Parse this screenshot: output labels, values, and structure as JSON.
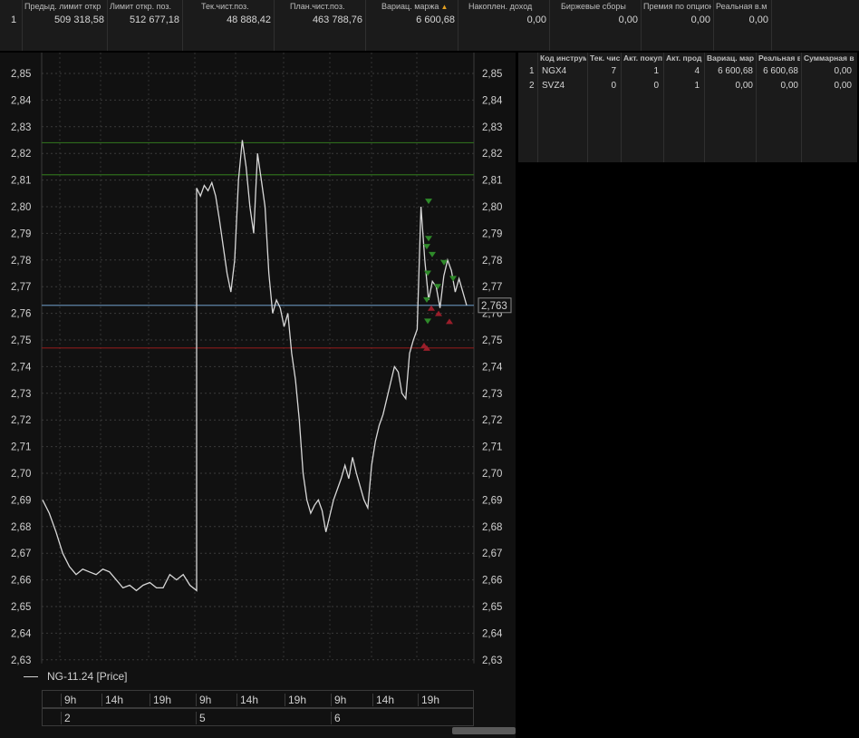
{
  "summary_table": {
    "headers": [
      "Предыд. лимит откр",
      "Лимит откр. поз.",
      "Тек.чист.поз.",
      "План.чист.поз.",
      "Вариац. маржа",
      "Накоплен. доход",
      "Биржевые сборы",
      "Премия по опцион",
      "Реальная в.м"
    ],
    "row_number": "1",
    "values": [
      "509 318,58",
      "512 677,18",
      "48 888,42",
      "463 788,76",
      "6 600,68",
      "0,00",
      "0,00",
      "0,00",
      "0,00"
    ],
    "sort_icon": "sort-ascending-icon"
  },
  "positions_table": {
    "headers": [
      "Код инструм",
      "Тек. чис",
      "Акт. покуп",
      "Акт. прод",
      "Вариац. мар",
      "Реальная в",
      "Суммарная в"
    ],
    "rows": [
      {
        "num": "1",
        "code": "NGX4",
        "cur": "7",
        "buy": "1",
        "sell": "4",
        "varmargin": "6 600,68",
        "real": "6 600,68",
        "total": "0,00"
      },
      {
        "num": "2",
        "code": "SVZ4",
        "cur": "0",
        "buy": "0",
        "sell": "1",
        "varmargin": "0,00",
        "real": "0,00",
        "total": "0,00"
      }
    ]
  },
  "chart": {
    "y_ticks": [
      "2,85",
      "2,84",
      "2,83",
      "2,82",
      "2,81",
      "2,80",
      "2,79",
      "2,78",
      "2,77",
      "2,76",
      "2,75",
      "2,74",
      "2,73",
      "2,72",
      "2,71",
      "2,70",
      "2,69",
      "2,68",
      "2,67",
      "2,66",
      "2,65",
      "2,64",
      "2,63"
    ],
    "current_price_label": "2,763",
    "legend_label": "NG-11.24 [Price]",
    "x_hours": [
      "9h",
      "14h",
      "19h",
      "9h",
      "14h",
      "19h",
      "9h",
      "14h",
      "19h"
    ],
    "x_days": [
      "2",
      "5",
      "6"
    ],
    "colors": {
      "background": "#111111",
      "price_line": "#d8d8d8",
      "green_level": "#2e6b1c",
      "red_level": "#8b1a1a",
      "current_level": "#5e84a8",
      "buy_marker": "#2f8a2a",
      "sell_marker": "#9a1e2a"
    }
  },
  "chart_data": {
    "type": "line",
    "title": "",
    "ylim": [
      2.63,
      2.855
    ],
    "series": [
      {
        "name": "NG-11.24 [Price]",
        "values": [
          2.69,
          2.685,
          2.678,
          2.67,
          2.665,
          2.662,
          2.664,
          2.663,
          2.662,
          2.664,
          2.663,
          2.66,
          2.657,
          2.658,
          2.656,
          2.658,
          2.659,
          2.657,
          2.657,
          2.662,
          2.66,
          2.662,
          2.658,
          2.656,
          2.807,
          2.804,
          2.808,
          2.806,
          2.809,
          2.804,
          2.795,
          2.785,
          2.775,
          2.768,
          2.78,
          2.81,
          2.825,
          2.815,
          2.8,
          2.79,
          2.82,
          2.81,
          2.8,
          2.775,
          2.76,
          2.765,
          2.762,
          2.755,
          2.76,
          2.745,
          2.735,
          2.72,
          2.7,
          2.69,
          2.685,
          2.688,
          2.69,
          2.686,
          2.678,
          2.684,
          2.69,
          2.694,
          2.698,
          2.703,
          2.698,
          2.706,
          2.7,
          2.695,
          2.69,
          2.687,
          2.703,
          2.712,
          2.718,
          2.722,
          2.728,
          2.734,
          2.74,
          2.738,
          2.73,
          2.728,
          2.745,
          2.75,
          2.754,
          2.8,
          2.78,
          2.765,
          2.772,
          2.77,
          2.762,
          2.774,
          2.78,
          2.776,
          2.768,
          2.773,
          2.768,
          2.763
        ]
      }
    ],
    "levels": {
      "green_upper": 2.824,
      "green_lower": 2.812,
      "current": 2.763,
      "red": 2.747
    },
    "buy_markers": [
      2.802,
      2.788,
      2.785,
      2.782,
      2.775,
      2.77,
      2.765,
      2.757,
      2.779,
      2.773
    ],
    "sell_markers": [
      2.762,
      2.76,
      2.757,
      2.748,
      2.747
    ]
  }
}
